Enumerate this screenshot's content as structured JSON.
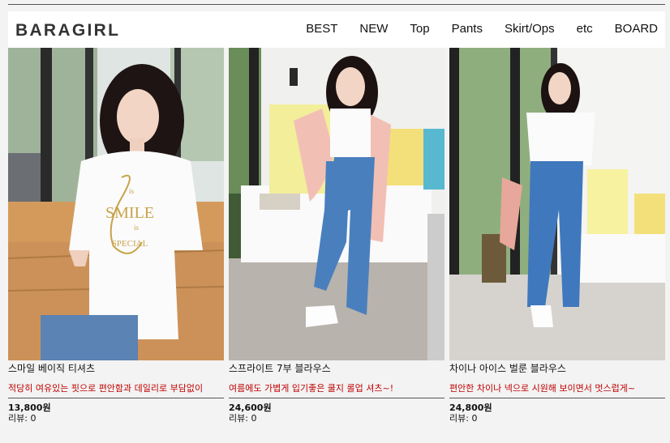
{
  "logo": "BARAGIRL",
  "nav": [
    "BEST",
    "NEW",
    "Top",
    "Pants",
    "Skirt/Ops",
    "etc",
    "BOARD"
  ],
  "products": [
    {
      "name": "스마일 베이직 티셔츠",
      "desc": "적당히 여유있는 핏으로 편안함과 데일리로 부담없이",
      "price": "13,800원",
      "reviews": "리뷰: 0"
    },
    {
      "name": "스프라이트 7부 블라우스",
      "desc": "여름에도 가볍게 입기좋은 쿨지 롤업 셔츠~!",
      "price": "24,600원",
      "reviews": "리뷰: 0"
    },
    {
      "name": "차이나 아이스 벌룬 블라우스",
      "desc": "편안한 차이나 넥으로 시원해 보이면서 멋스럽게~",
      "price": "24,800원",
      "reviews": "리뷰: 0"
    }
  ],
  "tshirt_print": [
    "SMILE",
    "is",
    "SPECIAL"
  ]
}
